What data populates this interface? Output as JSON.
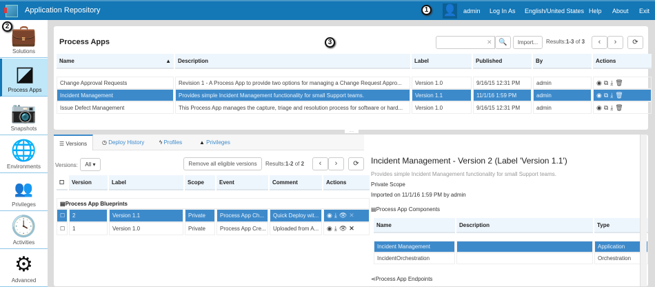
{
  "header": {
    "title": "Application Repository",
    "user": "admin",
    "links": [
      "Log In As",
      "English/United States",
      "Help",
      "About",
      "Exit"
    ],
    "callouts": [
      "1",
      "2",
      "3"
    ]
  },
  "sidebar": {
    "items": [
      {
        "label": "Solutions",
        "icon": "briefcase-icon"
      },
      {
        "label": "Process Apps",
        "icon": "shapes-icon",
        "selected": true
      },
      {
        "label": "Snapshots",
        "icon": "camera-icon"
      },
      {
        "label": "Environments",
        "icon": "globe-icon"
      },
      {
        "label": "Privileges",
        "icon": "users-icon"
      },
      {
        "label": "Activities",
        "icon": "clock-icon"
      },
      {
        "label": "Advanced",
        "icon": "gear-icon"
      }
    ]
  },
  "process_apps": {
    "title": "Process Apps",
    "search_value": "",
    "import_label": "Import...",
    "results_prefix": "Results:",
    "results_range": "1-3",
    "results_of": "of",
    "results_total": "3",
    "columns": [
      "Name",
      "Description",
      "Label",
      "Published",
      "By",
      "Actions"
    ],
    "rows": [
      {
        "name": "Change Approval Requests",
        "description": "Revision 1 - A Process App to provide two options for managing a Change Request Appro...",
        "label": "Version 1.0",
        "published": "9/16/15 12:31 PM",
        "by": "admin"
      },
      {
        "name": "Incident Management",
        "description": "Provides simple Incident Management functionality for small Support teams.",
        "label": "Version 1.1",
        "published": "11/1/16 1:59 PM",
        "by": "admin",
        "selected": true
      },
      {
        "name": "Issue Defect Management",
        "description": "This Process App manages the capture, triage and resolution process for software or hard...",
        "label": "Version 1.0",
        "published": "9/16/15 12:31 PM",
        "by": "admin"
      }
    ]
  },
  "tabs": [
    "Versions",
    "Deploy History",
    "Profiles",
    "Privileges"
  ],
  "versions": {
    "filter_label": "Versions:",
    "filter_value": "All",
    "remove_label": "Remove all eligible versions",
    "results_prefix": "Results:",
    "results_range": "1-2",
    "results_of": "of",
    "results_total": "2",
    "columns": [
      "Version",
      "Label",
      "Scope",
      "Event",
      "Comment",
      "Actions"
    ],
    "group": "Process App Blueprints",
    "rows": [
      {
        "version": "2",
        "label": "Version 1.1",
        "scope": "Private",
        "event": "Process App Ch...",
        "comment": "Quick Deploy wit...",
        "selected": true
      },
      {
        "version": "1",
        "label": "Version 1.0",
        "scope": "Private",
        "event": "Process App Cre...",
        "comment": "Uploaded from A..."
      }
    ]
  },
  "detail": {
    "title": "Incident Management - Version 2 (Label 'Version 1.1')",
    "description": "Provides simple Incident Management functionality for small Support teams.",
    "scope": "Private Scope",
    "imported": "Imported on 11/1/16 1:59 PM by admin",
    "components_title": "Process App Components",
    "columns": [
      "Name",
      "Description",
      "Type"
    ],
    "rows": [
      {
        "name": "Incident Management",
        "description": "",
        "type": "Application",
        "selected": true
      },
      {
        "name": "IncidentOrchestration",
        "description": "",
        "type": "Orchestration"
      }
    ],
    "endpoints_title": "Process App Endpoints"
  },
  "colors": {
    "header": "#1477b6",
    "selected_row": "#3d8acb",
    "sidebar_selected": "#bfe7f8"
  }
}
